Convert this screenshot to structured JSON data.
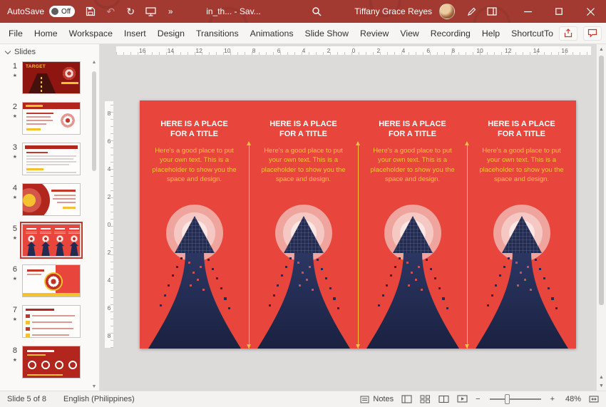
{
  "titlebar": {
    "autosave_label": "AutoSave",
    "autosave_state": "Off",
    "more_commands": "»",
    "doc_title": "in_th... - Sav...",
    "user_name": "Tiffany Grace Reyes"
  },
  "ribbon": {
    "tabs": [
      "File",
      "Home",
      "Workspace",
      "Insert",
      "Design",
      "Transitions",
      "Animations",
      "Slide Show",
      "Review",
      "View",
      "Recording",
      "Help",
      "ShortcutTo"
    ]
  },
  "slides_panel": {
    "header": "Slides",
    "slides": [
      {
        "num": "1",
        "starred": true,
        "selected": false,
        "label": "TARGET"
      },
      {
        "num": "2",
        "starred": true,
        "selected": false
      },
      {
        "num": "3",
        "starred": true,
        "selected": false
      },
      {
        "num": "4",
        "starred": true,
        "selected": false
      },
      {
        "num": "5",
        "starred": true,
        "selected": true
      },
      {
        "num": "6",
        "starred": true,
        "selected": false
      },
      {
        "num": "7",
        "starred": true,
        "selected": false
      },
      {
        "num": "8",
        "starred": true,
        "selected": false
      }
    ]
  },
  "rulers": {
    "horizontal": [
      "16",
      "14",
      "12",
      "10",
      "8",
      "6",
      "4",
      "2",
      "0",
      "2",
      "4",
      "6",
      "8",
      "10",
      "12",
      "14",
      "16"
    ],
    "vertical": [
      "8",
      "6",
      "4",
      "2",
      "0",
      "2",
      "4",
      "6",
      "8"
    ]
  },
  "slide": {
    "background_color": "#E8463C",
    "accent_color": "#FFC33F",
    "columns": [
      {
        "title": "HERE IS A PLACE FOR A TITLE",
        "body": "Here's a good place to put your own text. This is a placeholder to show you the space and design."
      },
      {
        "title": "HERE IS A PLACE FOR A TITLE",
        "body": "Here's a good place to put your own text. This is a placeholder to show you the space and design."
      },
      {
        "title": "HERE IS A PLACE FOR A TITLE",
        "body": "Here's a good place to put your own text. This is a placeholder to show you the space and design."
      },
      {
        "title": "HERE IS A PLACE FOR A TITLE",
        "body": "Here's a good place to put your own text. This is a placeholder to show you the space and design."
      }
    ]
  },
  "statusbar": {
    "slide_indicator": "Slide 5 of 8",
    "language": "English (Philippines)",
    "notes_label": "Notes",
    "zoom_level": "48%"
  },
  "glyphs": {
    "undo": "↶",
    "redo": "↻",
    "star": "★",
    "scroll_up": "▲",
    "scroll_down": "▼",
    "zoom_out": "−",
    "zoom_in": "+"
  }
}
